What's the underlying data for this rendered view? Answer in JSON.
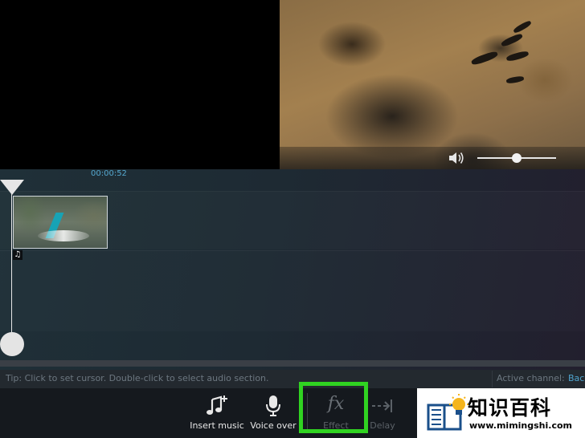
{
  "timeline": {
    "timecode": "00:00:52",
    "audio_note_icon": "music-note-icon"
  },
  "status": {
    "tip": "Tip: Click to set cursor. Double-click to select audio section.",
    "active_channel_label": "Active channel:",
    "active_channel_value": "Back"
  },
  "toolbar": {
    "insert_music": "Insert music",
    "voice_over": "Voice over",
    "effect": "Effect",
    "effect_icon_text": "fx",
    "delay": "Delay"
  },
  "watermark": {
    "title": "知识百科",
    "url": "www.mimingshi.com"
  },
  "colors": {
    "accent_blue": "#55a8cf",
    "highlight_green": "#30d321",
    "clip_sail": "#17a3b5"
  }
}
